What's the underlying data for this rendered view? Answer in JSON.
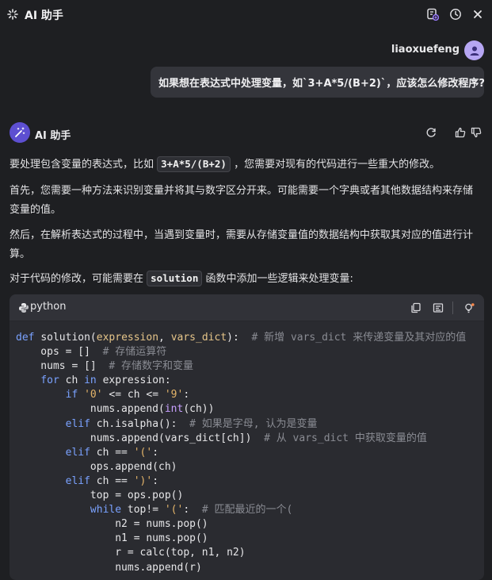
{
  "header": {
    "title": "AI 助手",
    "icons": [
      "sparkle-icon",
      "new-chat-icon",
      "history-icon",
      "close-icon"
    ]
  },
  "user": {
    "name": "liaoxuefeng",
    "message": "如果想在表达式中处理变量，如`3+A*5/(B+2)`，应该怎么修改程序?"
  },
  "assistant": {
    "name": "AI 助手",
    "actions": [
      "regenerate-icon",
      "thumbs-up-icon",
      "thumbs-down-icon"
    ],
    "p1": {
      "before": "要处理包含变量的表达式，比如 ",
      "code": "3+A*5/(B+2)",
      "after": " ，您需要对现有的代码进行一些重大的修改。"
    },
    "p2": "首先，您需要一种方法来识别变量并将其与数字区分开来。可能需要一个字典或者其他数据结构来存储变量的值。",
    "p3": "然后，在解析表达式的过程中，当遇到变量时，需要从存储变量值的数据结构中获取其对应的值进行计算。",
    "p4": {
      "before": "对于代码的修改，可能需要在 ",
      "code": "solution",
      "after": " 函数中添加一些逻辑来处理变量:"
    }
  },
  "code_block": {
    "language": "python",
    "tools": [
      "copy-icon",
      "insert-icon",
      "explain-icon"
    ]
  },
  "code_lines": [
    [
      [
        "kw",
        "def "
      ],
      [
        "fn",
        "solution("
      ],
      [
        "pm",
        "expression"
      ],
      [
        "fn",
        ", "
      ],
      [
        "pm",
        "vars_dict"
      ],
      [
        "fn",
        "):  "
      ],
      [
        "cm",
        "# 新增 vars_dict 来传递变量及其对应的值"
      ]
    ],
    [
      [
        "fn",
        "    ops = []  "
      ],
      [
        "cm",
        "# 存储运算符"
      ]
    ],
    [
      [
        "fn",
        "    nums = []  "
      ],
      [
        "cm",
        "# 存储数字和变量"
      ]
    ],
    [
      [
        "kw",
        "    for "
      ],
      [
        "fn",
        "ch "
      ],
      [
        "kw",
        "in "
      ],
      [
        "fn",
        "expression:"
      ]
    ],
    [
      [
        "kw",
        "        if "
      ],
      [
        "str",
        "'0'"
      ],
      [
        "fn",
        " <= ch <= "
      ],
      [
        "str",
        "'9'"
      ],
      [
        "fn",
        ":"
      ]
    ],
    [
      [
        "fn",
        "            nums.append("
      ],
      [
        "bi",
        "int"
      ],
      [
        "fn",
        "(ch))"
      ]
    ],
    [
      [
        "kw",
        "        elif "
      ],
      [
        "fn",
        "ch.isalpha():  "
      ],
      [
        "cm",
        "# 如果是字母, 认为是变量"
      ]
    ],
    [
      [
        "fn",
        "            nums.append(vars_dict[ch])  "
      ],
      [
        "cm",
        "# 从 vars_dict 中获取变量的值"
      ]
    ],
    [
      [
        "kw",
        "        elif "
      ],
      [
        "fn",
        "ch == "
      ],
      [
        "str",
        "'('"
      ],
      [
        "fn",
        ":"
      ]
    ],
    [
      [
        "fn",
        "            ops.append(ch)"
      ]
    ],
    [
      [
        "kw",
        "        elif "
      ],
      [
        "fn",
        "ch == "
      ],
      [
        "str",
        "')'"
      ],
      [
        "fn",
        ":"
      ]
    ],
    [
      [
        "fn",
        "            top = ops.pop()"
      ]
    ],
    [
      [
        "kw",
        "            while "
      ],
      [
        "fn",
        "top!= "
      ],
      [
        "str",
        "'('"
      ],
      [
        "fn",
        ":  "
      ],
      [
        "cm",
        "# 匹配最近的一个("
      ]
    ],
    [
      [
        "fn",
        "                n2 = nums.pop()"
      ]
    ],
    [
      [
        "fn",
        "                n1 = nums.pop()"
      ]
    ],
    [
      [
        "fn",
        "                r = calc(top, n1, n2)"
      ]
    ],
    [
      [
        "fn",
        "                nums.append(r)"
      ]
    ]
  ]
}
